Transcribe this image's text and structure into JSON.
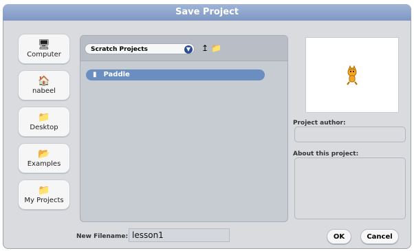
{
  "dialog": {
    "title": "Save Project"
  },
  "sidebar": [
    {
      "label": "Computer",
      "icon": "computer-icon",
      "glyph": "🖥"
    },
    {
      "label": "nabeel",
      "icon": "home-icon",
      "glyph": "🏠"
    },
    {
      "label": "Desktop",
      "icon": "folder-icon",
      "glyph": "📁"
    },
    {
      "label": "Examples",
      "icon": "examples-icon",
      "glyph": "📂"
    },
    {
      "label": "My Projects",
      "icon": "folder-icon",
      "glyph": "📁"
    }
  ],
  "browser": {
    "location": "Scratch Projects",
    "up_glyph": "↥",
    "newfolder_glyph": "📁",
    "files": [
      {
        "name": "Paddle",
        "selected": true
      }
    ]
  },
  "details": {
    "author_label": "Project author:",
    "author_value": "",
    "about_label": "About this project:",
    "about_value": ""
  },
  "save": {
    "filename_label": "New Filename:",
    "filename_value": "lesson1"
  },
  "buttons": {
    "ok": "OK",
    "cancel": "Cancel"
  },
  "colors": {
    "title_bar": "#7f97c3",
    "selected_row": "#6a8ec0",
    "panel": "#c7ccd3"
  }
}
